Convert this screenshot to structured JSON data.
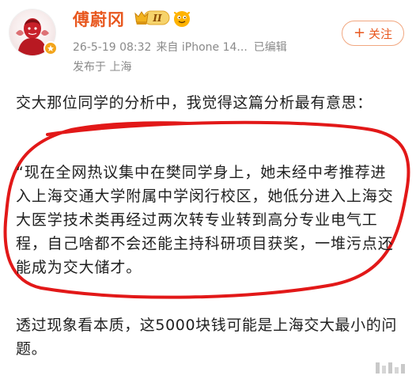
{
  "post": {
    "author": {
      "name": "傅蔚冈",
      "vip_badge": "II",
      "avatar_icon": "avatar-portrait-icon",
      "verified_icon": "verified-badge-icon"
    },
    "meta": {
      "time": "26-5-19 08:32",
      "source_prefix": "来自",
      "source_device": "iPhone 14...",
      "edited": "已编辑",
      "location": "发布于 上海"
    },
    "follow_button": {
      "plus": "+",
      "label": "关注"
    },
    "intro_text": "交大那位同学的分析中，我觉得这篇分析最有意思：",
    "quote_text": "“现在全网热议集中在樊同学身上，她未经中考推荐进入上海交通大学附属中学闵行校区，她低分进入上海交大医学技术类再经过两次转专业转到高分专业电气工程，自己啥都不会还能主持科研项目获奖，一堆污点还能成为交大储才。",
    "closing_text": "透过现象看本质，这5000块钱可能是上海交大最小的问题。"
  },
  "colors": {
    "accent": "#e8571e",
    "annotation": "#e21818",
    "meta_gray": "#8a8a8a",
    "text": "#1f1f1f"
  }
}
